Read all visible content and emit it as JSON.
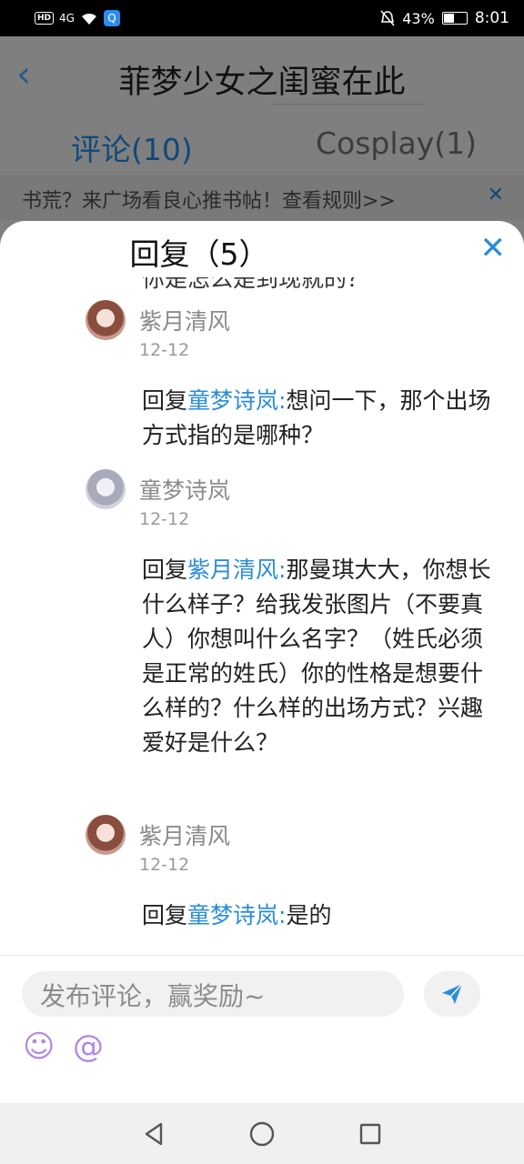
{
  "status_bar": {
    "hd": "HD",
    "signal": "4G",
    "battery": "43%",
    "battery_level": 0.43,
    "time": "8:01"
  },
  "page": {
    "title": "菲梦少女之闺蜜在此",
    "tabs": [
      {
        "label": "评论(10)",
        "active": true
      },
      {
        "label": "Cosplay(1)",
        "active": false
      }
    ],
    "notice": "书荒？来广场看良心推书帖！查看规则>>"
  },
  "sheet": {
    "title": "回复（5）",
    "close_icon": "close-icon",
    "cut_off_text": "你是怎么是到现就的？",
    "replies": [
      {
        "user": "紫月清风",
        "date": "12-12",
        "prefix": "回复",
        "mention": "童梦诗岚:",
        "text": "想问一下，那个出场方式指的是哪种？"
      },
      {
        "user": "童梦诗岚",
        "date": "12-12",
        "prefix": "回复",
        "mention": "紫月清风:",
        "text": "那曼琪大大，你想长什么样子？给我发张图片（不要真人）你想叫什么名字？（姓氏必须是正常的姓氏）你的性格是想要什么样的？什么样的出场方式？兴趣爱好是什么？"
      },
      {
        "user": "紫月清风",
        "date": "12-12",
        "prefix": "回复",
        "mention": "童梦诗岚:",
        "text": "是的"
      }
    ]
  },
  "composer": {
    "placeholder": "发布评论，赢奖励~",
    "send_icon": "send-icon",
    "emoji_icon": "emoji-icon",
    "mention_icon": "at-icon",
    "mention_label": "@"
  },
  "colors": {
    "accent": "#2a8cd8",
    "emoji": "#b08ae0"
  }
}
